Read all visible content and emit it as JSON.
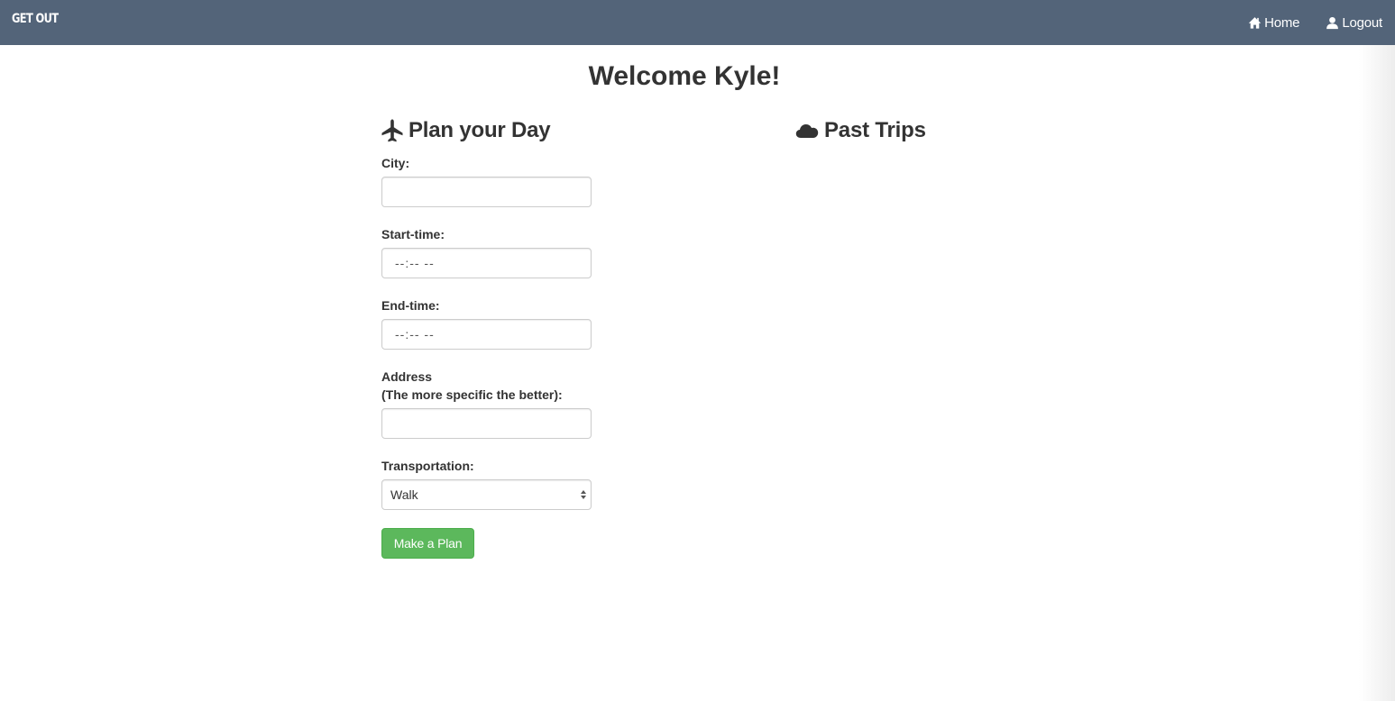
{
  "navbar": {
    "brand": "GET OUT",
    "links": [
      {
        "label": "Home",
        "icon": "home-icon"
      },
      {
        "label": "Logout",
        "icon": "user-icon"
      }
    ],
    "background": "#536479"
  },
  "main": {
    "welcome": "Welcome Kyle!"
  },
  "plan": {
    "title": "Plan your Day",
    "icon": "plane-icon",
    "city": {
      "label": "City:",
      "value": ""
    },
    "start_time": {
      "label": "Start-time:",
      "value": "--:-- --"
    },
    "end_time": {
      "label": "End-time:",
      "value": "--:-- --"
    },
    "address": {
      "label_line1": "Address",
      "label_line2": "(The more specific the better):",
      "value": ""
    },
    "transportation": {
      "label": "Transportation:",
      "selected": "Walk"
    },
    "submit_label": "Make a Plan",
    "submit_color": "#5cb85c"
  },
  "past_trips": {
    "title": "Past Trips",
    "icon": "cloud-icon"
  }
}
